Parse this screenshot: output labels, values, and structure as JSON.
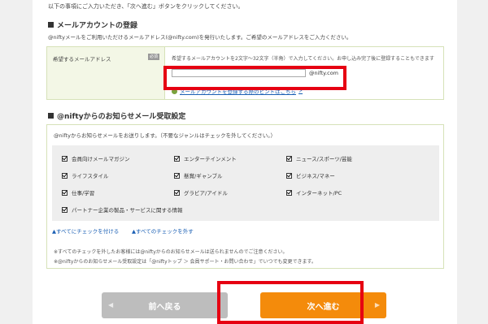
{
  "intro": "以下の事項にご入力いただき、「次へ進む」ボタンをクリックしてください。",
  "mail_section": {
    "title": "メールアカウントの登録",
    "desc": "@niftyメールをご利用いただけるメールアドレス(@nifty.com)を発行いたします。ご希望のメールアドレスをご入力ください。",
    "label": "希望するメールアドレス",
    "required_badge": "必須",
    "hint": "希望するメールアカウントを2文字～32文字（半角）で入力してください。お申し込み完了後に登録することもできます",
    "input_value": "",
    "domain": "@nifty.com",
    "help_link": "メールアカウントを登録する際のヒントはこちら"
  },
  "notice_section": {
    "title": "@niftyからのお知らせメール受取設定",
    "desc": "@niftyからお知らせメールをお送りします。（不要なジャンルはチェックを外してください。）",
    "checkboxes": [
      {
        "label": "会員向けメールマガジン",
        "checked": true
      },
      {
        "label": "エンターテインメント",
        "checked": true
      },
      {
        "label": "ニュース/スポーツ/芸能",
        "checked": true
      },
      {
        "label": "ライフスタイル",
        "checked": true
      },
      {
        "label": "懸賞/ギャンブル",
        "checked": true
      },
      {
        "label": "ビジネス/マネー",
        "checked": true
      },
      {
        "label": "仕事/学習",
        "checked": true
      },
      {
        "label": "グラビア/アイドル",
        "checked": true
      },
      {
        "label": "インターネット/PC",
        "checked": true
      },
      {
        "label": "パートナー企業の製品・サービスに関する情報",
        "checked": true
      }
    ],
    "check_all": "▲すべてにチェックを付ける",
    "uncheck_all": "▲すべてのチェックを外す",
    "note1": "※すべてのチェックを外したお客様には@niftyからのお知らせメールは送られませんのでご注意ください。",
    "note2": "※@niftyからのお知らせメール受取設定は「@niftyトップ ＞ 会員サポート・お問い合わせ」でいつでも変更できます。"
  },
  "buttons": {
    "back": "前へ戻る",
    "next": "次へ進む"
  },
  "colors": {
    "highlight": "#e60012",
    "next_button": "#f48b0b",
    "back_button": "#bdbdbd"
  }
}
